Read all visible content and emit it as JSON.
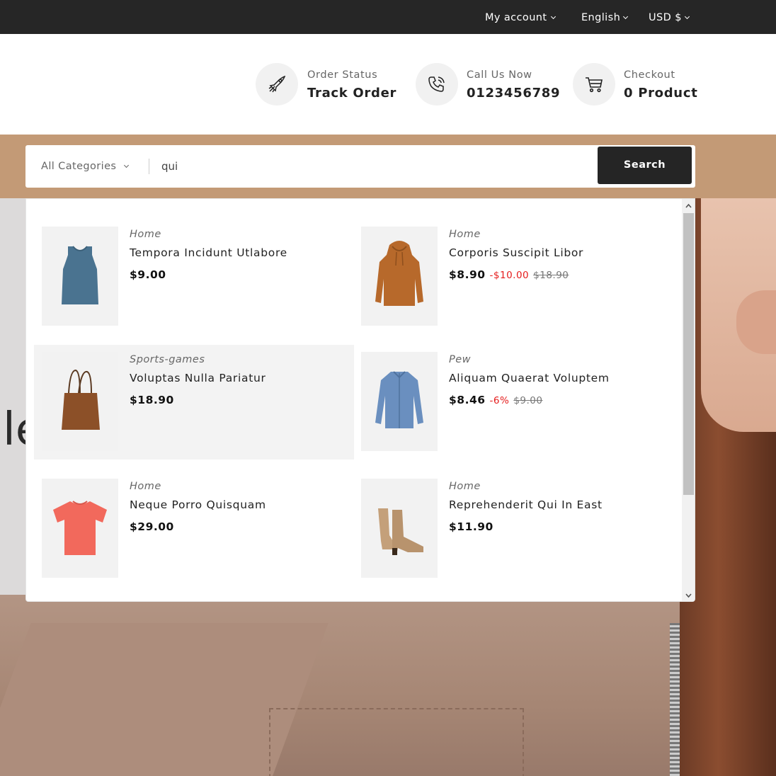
{
  "topbar": {
    "account_label": "My account",
    "language_label": "English",
    "currency_label": "USD $"
  },
  "header": {
    "order": {
      "small": "Order Status",
      "big": "Track Order",
      "icon": "rocket-icon"
    },
    "call": {
      "small": "Call Us Now",
      "big": "0123456789",
      "icon": "phone-icon"
    },
    "checkout": {
      "small": "Checkout",
      "big": "0 Product",
      "icon": "cart-icon"
    }
  },
  "search": {
    "category_label": "All Categories",
    "query": "qui",
    "button_label": "Search"
  },
  "hero": {
    "headline_fragment": "le"
  },
  "results": [
    {
      "category": "Home",
      "name": "Tempora Incidunt Utlabore",
      "price": "$9.00",
      "discount": "",
      "old_price": "",
      "image": "tank-top-blue"
    },
    {
      "category": "Home",
      "name": "Corporis Suscipit Libor",
      "price": "$8.90",
      "discount": "-$10.00",
      "old_price": "$18.90",
      "image": "hoodie-orange"
    },
    {
      "category": "Sports-games",
      "name": "Voluptas Nulla Pariatur",
      "price": "$18.90",
      "discount": "",
      "old_price": "",
      "image": "tote-bag-brown"
    },
    {
      "category": "Pew",
      "name": "Aliquam Quaerat Voluptem",
      "price": "$8.46",
      "discount": "-6%",
      "old_price": "$9.00",
      "image": "shirt-denim"
    },
    {
      "category": "Home",
      "name": "Neque Porro Quisquam",
      "price": "$29.00",
      "discount": "",
      "old_price": "",
      "image": "tshirt-coral"
    },
    {
      "category": "Home",
      "name": "Reprehenderit Qui In East",
      "price": "$11.90",
      "discount": "",
      "old_price": "",
      "image": "ankle-boots-beige"
    }
  ],
  "colors": {
    "topbar_bg": "#262626",
    "search_band": "#c39a76",
    "button_bg": "#252525",
    "discount_red": "#e51c1c"
  }
}
